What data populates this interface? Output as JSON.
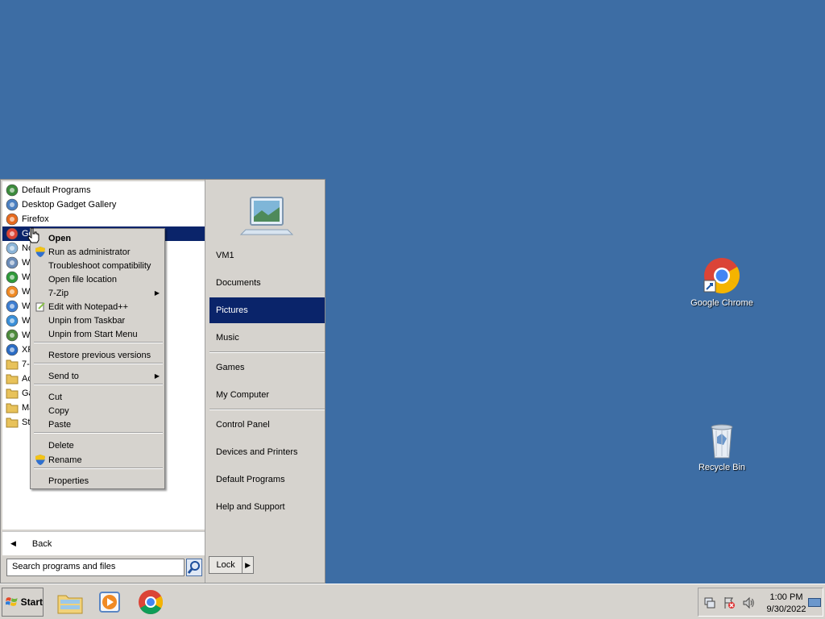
{
  "desktop": {
    "icons": [
      {
        "name": "google-chrome-desktop-icon",
        "label": "Google Chrome"
      },
      {
        "name": "recycle-bin-desktop-icon",
        "label": "Recycle Bin"
      }
    ]
  },
  "start_menu": {
    "programs": [
      {
        "label": "Default Programs",
        "icon": "default-programs-icon"
      },
      {
        "label": "Desktop Gadget Gallery",
        "icon": "gadget-gallery-icon"
      },
      {
        "label": "Firefox",
        "icon": "firefox-icon"
      },
      {
        "label": "Google Chrome",
        "icon": "chrome-icon",
        "selected": true
      },
      {
        "label": "Notepad",
        "icon": "notepad-icon"
      },
      {
        "label": "Windows Fax and Scan",
        "icon": "fax-icon"
      },
      {
        "label": "Windows Media Center",
        "icon": "media-center-icon"
      },
      {
        "label": "Windows Media Player",
        "icon": "media-player-icon"
      },
      {
        "label": "Windows Update",
        "icon": "windows-update-icon"
      },
      {
        "label": "Windows Live",
        "icon": "windows-live-icon"
      },
      {
        "label": "Windows Explorer",
        "icon": "explorer-icon"
      },
      {
        "label": "XPS Viewer",
        "icon": "xps-icon"
      },
      {
        "label": "7-Zip",
        "icon": "folder-icon"
      },
      {
        "label": "Accessories",
        "icon": "folder-icon"
      },
      {
        "label": "Games",
        "icon": "folder-icon"
      },
      {
        "label": "Maintenance",
        "icon": "folder-icon"
      },
      {
        "label": "Startup",
        "icon": "folder-icon"
      }
    ],
    "back_label": "Back",
    "search_placeholder": "Search programs and files",
    "right_items": [
      {
        "label": "VM1"
      },
      {
        "label": "Documents"
      },
      {
        "label": "Pictures",
        "selected": true
      },
      {
        "label": "Music"
      },
      {
        "label": "Games"
      },
      {
        "label": "My Computer"
      },
      {
        "label": "Control Panel"
      },
      {
        "label": "Devices and Printers"
      },
      {
        "label": "Default Programs"
      },
      {
        "label": "Help and Support"
      }
    ],
    "lock_label": "Lock"
  },
  "context_menu": {
    "items": [
      {
        "label": "Open",
        "bold": true
      },
      {
        "label": "Run as administrator",
        "shield": true
      },
      {
        "label": "Troubleshoot compatibility"
      },
      {
        "label": "Open file location"
      },
      {
        "label": "7-Zip",
        "submenu": true
      },
      {
        "label": "Edit with Notepad++"
      },
      {
        "label": "Unpin from Taskbar"
      },
      {
        "label": "Unpin from Start Menu"
      },
      {
        "label": "Restore previous versions"
      },
      {
        "label": "Send to",
        "submenu": true
      },
      {
        "label": "Cut"
      },
      {
        "label": "Copy"
      },
      {
        "label": "Paste"
      },
      {
        "label": "Delete"
      },
      {
        "label": "Rename",
        "shield": true
      },
      {
        "label": "Properties"
      }
    ]
  },
  "taskbar": {
    "start_label": "Start",
    "time": "1:00 PM",
    "date": "9/30/2022"
  },
  "colors": {
    "desktop": "#3d6da4",
    "selection": "#0a246a",
    "menu_bg": "#d6d3ce"
  }
}
